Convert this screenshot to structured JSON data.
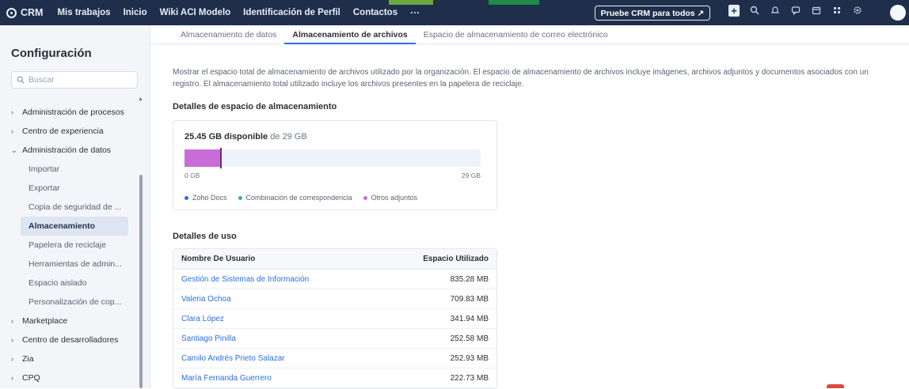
{
  "topbar": {
    "brand": "CRM",
    "nav": [
      "Mis trabajos",
      "Inicio",
      "Wiki ACI Modelo",
      "Identificación de Perfil",
      "Contactos"
    ],
    "more": "···",
    "trial_button": "Pruebe CRM para todos ↗",
    "icons": [
      "add-icon",
      "search-icon",
      "bell-icon",
      "chat-icon",
      "calendar-icon",
      "apps-icon",
      "settings-icon"
    ]
  },
  "sidebar": {
    "title": "Configuración",
    "search_placeholder": "Buscar",
    "items": [
      {
        "label": "Administración de procesos",
        "type": "category",
        "chevron": "›"
      },
      {
        "label": "Centro de experiencia",
        "type": "category",
        "chevron": "›"
      },
      {
        "label": "Administración de datos",
        "type": "category",
        "chevron": "⌄"
      },
      {
        "label": "Importar",
        "type": "sub"
      },
      {
        "label": "Exportar",
        "type": "sub"
      },
      {
        "label": "Copia de seguridad de ...",
        "type": "sub"
      },
      {
        "label": "Almacenamiento",
        "type": "active"
      },
      {
        "label": "Papelera de reciclaje",
        "type": "sub"
      },
      {
        "label": "Herramientas de admin...",
        "type": "sub"
      },
      {
        "label": "Espacio aislado",
        "type": "sub"
      },
      {
        "label": "Personalización de cop...",
        "type": "sub"
      },
      {
        "label": "Marketplace",
        "type": "category",
        "chevron": "›"
      },
      {
        "label": "Centro de desarrolladores",
        "type": "category",
        "chevron": "›"
      },
      {
        "label": "Zia",
        "type": "category",
        "chevron": "›"
      },
      {
        "label": "CPQ",
        "type": "category",
        "chevron": "›"
      }
    ]
  },
  "tabs": [
    {
      "label": "Almacenamiento de datos",
      "active": false
    },
    {
      "label": "Almacenamiento de archivos",
      "active": true
    },
    {
      "label": "Espacio de almacenamiento de correo electrónico",
      "active": false
    }
  ],
  "description": "Mostrar el espacio total de almacenamiento de archivos utilizado por la organización. El espacio de almacenamiento de archivos incluye imágenes, archivos adjuntos y documentos asociados con un registro. El almacenamiento total utilizado incluye los archivos presentes en la papelera de reciclaje.",
  "storage": {
    "section_title": "Detalles de espacio de almacenamiento",
    "available_bold": "25.45 GB disponible",
    "available_of": "de 29 GB",
    "used_fraction": 0.122,
    "min_label": "0 GB",
    "max_label": "29 GB",
    "legend": [
      {
        "label": "Zoho Docs",
        "color": "#2b6ee6"
      },
      {
        "label": "Combinación de correspondencia",
        "color": "#2bb5a8"
      },
      {
        "label": "Otros adjuntos",
        "color": "#c86dd7"
      }
    ]
  },
  "usage": {
    "section_title": "Detalles de uso",
    "col_user": "Nombre De Usuario",
    "col_space": "Espacio Utilizado",
    "rows": [
      {
        "name": "Gestión de Sistemas de Información",
        "size": "835.28 MB"
      },
      {
        "name": "Valeria Ochoa",
        "size": "709.83 MB"
      },
      {
        "name": "Clara López",
        "size": "341.94 MB"
      },
      {
        "name": "Santiago Pinilla",
        "size": "252.58 MB"
      },
      {
        "name": "Camilo Andrés Prieto Salazar",
        "size": "252.93 MB"
      },
      {
        "name": "María Fernanda Guerrero",
        "size": "222.73 MB"
      }
    ]
  }
}
